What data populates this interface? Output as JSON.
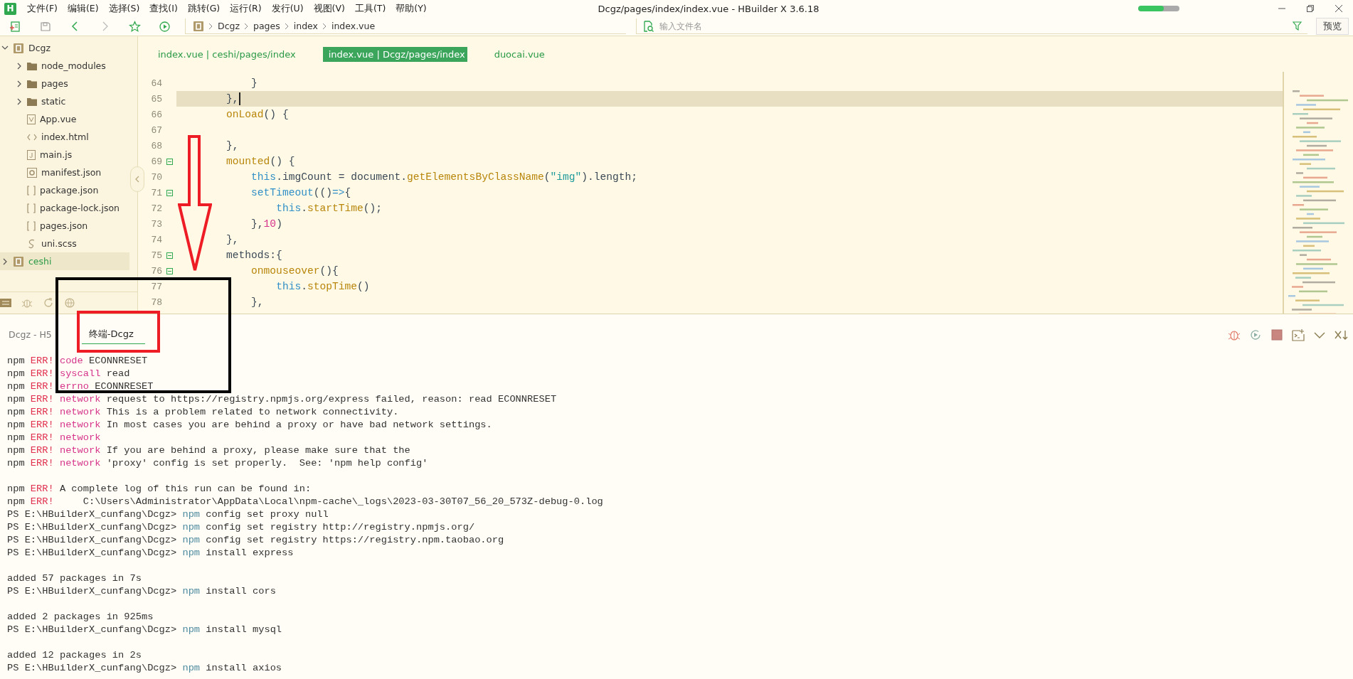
{
  "app": {
    "logo": "H",
    "title": "Dcgz/pages/index/index.vue - HBuilder X 3.6.18",
    "progress": {
      "level": 0.62
    }
  },
  "menu": [
    "文件(F)",
    "编辑(E)",
    "选择(S)",
    "查找(I)",
    "跳转(G)",
    "运行(R)",
    "发行(U)",
    "视图(V)",
    "工具(T)",
    "帮助(Y)"
  ],
  "breadcrumbs": [
    "Dcgz",
    "pages",
    "index",
    "index.vue"
  ],
  "file_search": {
    "placeholder": "输入文件名"
  },
  "preview_button": "预览",
  "sidebar": {
    "items": [
      {
        "label": "Dcgz",
        "kind": "project",
        "expanded": true,
        "selected": false,
        "children": [
          {
            "label": "node_modules",
            "kind": "folder",
            "expanded": false,
            "selected": false
          },
          {
            "label": "pages",
            "kind": "folder",
            "expanded": false,
            "selected": false
          },
          {
            "label": "static",
            "kind": "folder",
            "expanded": false,
            "selected": false
          },
          {
            "label": "App.vue",
            "kind": "vue",
            "selected": false
          },
          {
            "label": "index.html",
            "kind": "html",
            "selected": false
          },
          {
            "label": "main.js",
            "kind": "js",
            "selected": false
          },
          {
            "label": "manifest.json",
            "kind": "manifest",
            "selected": false
          },
          {
            "label": "package.json",
            "kind": "json",
            "selected": false
          },
          {
            "label": "package-lock.json",
            "kind": "json",
            "selected": false
          },
          {
            "label": "pages.json",
            "kind": "json",
            "selected": false
          },
          {
            "label": "uni.scss",
            "kind": "scss",
            "selected": false
          }
        ]
      },
      {
        "label": "ceshi",
        "kind": "project",
        "expanded": false,
        "selected": true
      }
    ]
  },
  "editor": {
    "tabs": [
      {
        "label": "index.vue | ceshi/pages/index",
        "selected": false
      },
      {
        "label": "index.vue | Dcgz/pages/index",
        "selected": true
      },
      {
        "label": "duocai.vue",
        "selected": false
      }
    ],
    "lines": [
      {
        "number": "64",
        "fold": false,
        "current": false,
        "tokens": [
          {
            "text": "            }",
            "kind": "plain"
          }
        ]
      },
      {
        "number": "65",
        "fold": false,
        "current": true,
        "tokens": [
          {
            "text": "        },",
            "kind": "plain"
          }
        ]
      },
      {
        "number": "66",
        "fold": false,
        "current": false,
        "tokens": [
          {
            "text": "        onLoad",
            "kind": "fn"
          },
          {
            "text": "() {",
            "kind": "plain"
          }
        ]
      },
      {
        "number": "67",
        "fold": false,
        "current": false
      },
      {
        "number": "68",
        "fold": false,
        "current": false,
        "tokens": [
          {
            "text": "        },",
            "kind": "plain"
          }
        ]
      },
      {
        "number": "69",
        "fold": true,
        "current": false,
        "tokens": [
          {
            "text": "        mounted",
            "kind": "fn"
          },
          {
            "text": "() {",
            "kind": "plain"
          }
        ]
      },
      {
        "number": "70",
        "fold": false,
        "current": false,
        "tokens": [
          {
            "text": "            this",
            "kind": "kw"
          },
          {
            "text": ".imgCount = document.",
            "kind": "plain"
          },
          {
            "text": "getElementsByClassName",
            "kind": "fn"
          },
          {
            "text": "(",
            "kind": "plain"
          },
          {
            "text": "\"img\"",
            "kind": "str"
          },
          {
            "text": ").length;",
            "kind": "plain"
          }
        ]
      },
      {
        "number": "71",
        "fold": true,
        "current": false,
        "tokens": [
          {
            "text": "            setTimeout",
            "kind": "kw"
          },
          {
            "text": "(()",
            "kind": "plain"
          },
          {
            "text": "=>",
            "kind": "kw"
          },
          {
            "text": "{",
            "kind": "plain"
          }
        ]
      },
      {
        "number": "72",
        "fold": false,
        "current": false,
        "tokens": [
          {
            "text": "                this",
            "kind": "kw"
          },
          {
            "text": ".",
            "kind": "plain"
          },
          {
            "text": "startTime",
            "kind": "fn"
          },
          {
            "text": "();",
            "kind": "plain"
          }
        ]
      },
      {
        "number": "73",
        "fold": false,
        "current": false,
        "tokens": [
          {
            "text": "            },",
            "kind": "plain"
          },
          {
            "text": "10",
            "kind": "num"
          },
          {
            "text": ")",
            "kind": "plain"
          }
        ]
      },
      {
        "number": "74",
        "fold": false,
        "current": false,
        "tokens": [
          {
            "text": "        },",
            "kind": "plain"
          }
        ]
      },
      {
        "number": "75",
        "fold": true,
        "current": false,
        "tokens": [
          {
            "text": "        methods:{",
            "kind": "plain"
          }
        ]
      },
      {
        "number": "76",
        "fold": true,
        "current": false,
        "tokens": [
          {
            "text": "            onmouseover",
            "kind": "fn"
          },
          {
            "text": "(){",
            "kind": "plain"
          }
        ]
      },
      {
        "number": "77",
        "fold": false,
        "current": false,
        "tokens": [
          {
            "text": "                this",
            "kind": "kw"
          },
          {
            "text": ".",
            "kind": "plain"
          },
          {
            "text": "stopTime",
            "kind": "fn"
          },
          {
            "text": "()",
            "kind": "plain"
          }
        ]
      },
      {
        "number": "78",
        "fold": false,
        "current": false,
        "tokens": [
          {
            "text": "            },",
            "kind": "plain"
          }
        ]
      }
    ]
  },
  "terminal": {
    "tabs": [
      {
        "label": "Dcgz - H5",
        "selected": false
      },
      {
        "label": "终端-Dcgz",
        "selected": true
      }
    ],
    "lines": [
      {
        "tokens": [
          {
            "text": "npm ",
            "kind": "text"
          },
          {
            "text": "ERR! ",
            "kind": "error"
          },
          {
            "text": "code ",
            "kind": "tag"
          },
          {
            "text": "ECONNRESET",
            "kind": "text"
          }
        ]
      },
      {
        "tokens": [
          {
            "text": "npm ",
            "kind": "text"
          },
          {
            "text": "ERR! ",
            "kind": "error"
          },
          {
            "text": "syscall ",
            "kind": "tag"
          },
          {
            "text": "read",
            "kind": "text"
          }
        ]
      },
      {
        "tokens": [
          {
            "text": "npm ",
            "kind": "text"
          },
          {
            "text": "ERR! ",
            "kind": "error"
          },
          {
            "text": "errno ",
            "kind": "tag"
          },
          {
            "text": "ECONNRESET",
            "kind": "text"
          }
        ]
      },
      {
        "tokens": [
          {
            "text": "npm ",
            "kind": "text"
          },
          {
            "text": "ERR! ",
            "kind": "error"
          },
          {
            "text": "network ",
            "kind": "tag"
          },
          {
            "text": "request to https://registry.npmjs.org/express failed, reason: read ECONNRESET",
            "kind": "text"
          }
        ]
      },
      {
        "tokens": [
          {
            "text": "npm ",
            "kind": "text"
          },
          {
            "text": "ERR! ",
            "kind": "error"
          },
          {
            "text": "network ",
            "kind": "tag"
          },
          {
            "text": "This is a problem related to network connectivity.",
            "kind": "text"
          }
        ]
      },
      {
        "tokens": [
          {
            "text": "npm ",
            "kind": "text"
          },
          {
            "text": "ERR! ",
            "kind": "error"
          },
          {
            "text": "network ",
            "kind": "tag"
          },
          {
            "text": "In most cases you are behind a proxy or have bad network settings.",
            "kind": "text"
          }
        ]
      },
      {
        "tokens": [
          {
            "text": "npm ",
            "kind": "text"
          },
          {
            "text": "ERR! ",
            "kind": "error"
          },
          {
            "text": "network",
            "kind": "tag"
          }
        ]
      },
      {
        "tokens": [
          {
            "text": "npm ",
            "kind": "text"
          },
          {
            "text": "ERR! ",
            "kind": "error"
          },
          {
            "text": "network ",
            "kind": "tag"
          },
          {
            "text": "If you are behind a proxy, please make sure that the",
            "kind": "text"
          }
        ]
      },
      {
        "tokens": [
          {
            "text": "npm ",
            "kind": "text"
          },
          {
            "text": "ERR! ",
            "kind": "error"
          },
          {
            "text": "network ",
            "kind": "tag"
          },
          {
            "text": "'proxy' config is set properly.  See: 'npm help config'",
            "kind": "text"
          }
        ]
      },
      {
        "gap_before": true,
        "tokens": [
          {
            "text": "npm ",
            "kind": "text"
          },
          {
            "text": "ERR! ",
            "kind": "error"
          },
          {
            "text": "A complete log of this run can be found in:",
            "kind": "text"
          }
        ]
      },
      {
        "tokens": [
          {
            "text": "npm ",
            "kind": "text"
          },
          {
            "text": "ERR! ",
            "kind": "error"
          },
          {
            "text": "    C:\\Users\\Administrator\\AppData\\Local\\npm-cache\\_logs\\2023-03-30T07_56_20_573Z-debug-0.log",
            "kind": "text"
          }
        ]
      },
      {
        "tokens": [
          {
            "text": "PS E:\\HBuilderX_cunfang\\Dcgz> ",
            "kind": "text"
          },
          {
            "text": "npm",
            "kind": "command"
          },
          {
            "text": " config set proxy null",
            "kind": "text"
          }
        ]
      },
      {
        "tokens": [
          {
            "text": "PS E:\\HBuilderX_cunfang\\Dcgz> ",
            "kind": "text"
          },
          {
            "text": "npm",
            "kind": "command"
          },
          {
            "text": " config set registry http://registry.npmjs.org/",
            "kind": "text"
          }
        ]
      },
      {
        "tokens": [
          {
            "text": "PS E:\\HBuilderX_cunfang\\Dcgz> ",
            "kind": "text"
          },
          {
            "text": "npm",
            "kind": "command"
          },
          {
            "text": " config set registry https://registry.npm.taobao.org",
            "kind": "text"
          }
        ]
      },
      {
        "tokens": [
          {
            "text": "PS E:\\HBuilderX_cunfang\\Dcgz> ",
            "kind": "text"
          },
          {
            "text": "npm",
            "kind": "command"
          },
          {
            "text": " install express",
            "kind": "text"
          }
        ]
      },
      {
        "gap_before": true,
        "tokens": [
          {
            "text": "added 57 packages in 7s",
            "kind": "text"
          }
        ]
      },
      {
        "tokens": [
          {
            "text": "PS E:\\HBuilderX_cunfang\\Dcgz> ",
            "kind": "text"
          },
          {
            "text": "npm",
            "kind": "command"
          },
          {
            "text": " install cors",
            "kind": "text"
          }
        ]
      },
      {
        "gap_before": true,
        "tokens": [
          {
            "text": "added 2 packages in 925ms",
            "kind": "text"
          }
        ]
      },
      {
        "tokens": [
          {
            "text": "PS E:\\HBuilderX_cunfang\\Dcgz> ",
            "kind": "text"
          },
          {
            "text": "npm",
            "kind": "command"
          },
          {
            "text": " install mysql",
            "kind": "text"
          }
        ]
      },
      {
        "gap_before": true,
        "tokens": [
          {
            "text": "added 12 packages in 2s",
            "kind": "text"
          }
        ]
      },
      {
        "tokens": [
          {
            "text": "PS E:\\HBuilderX_cunfang\\Dcgz> ",
            "kind": "text"
          },
          {
            "text": "npm",
            "kind": "command"
          },
          {
            "text": " install axios",
            "kind": "text"
          }
        ]
      }
    ]
  },
  "annotations": [
    {
      "kind": "arrow",
      "color": "#ee1c25"
    },
    {
      "kind": "frame",
      "color": "#000000"
    },
    {
      "kind": "frame",
      "color": "#ee1c25"
    }
  ]
}
